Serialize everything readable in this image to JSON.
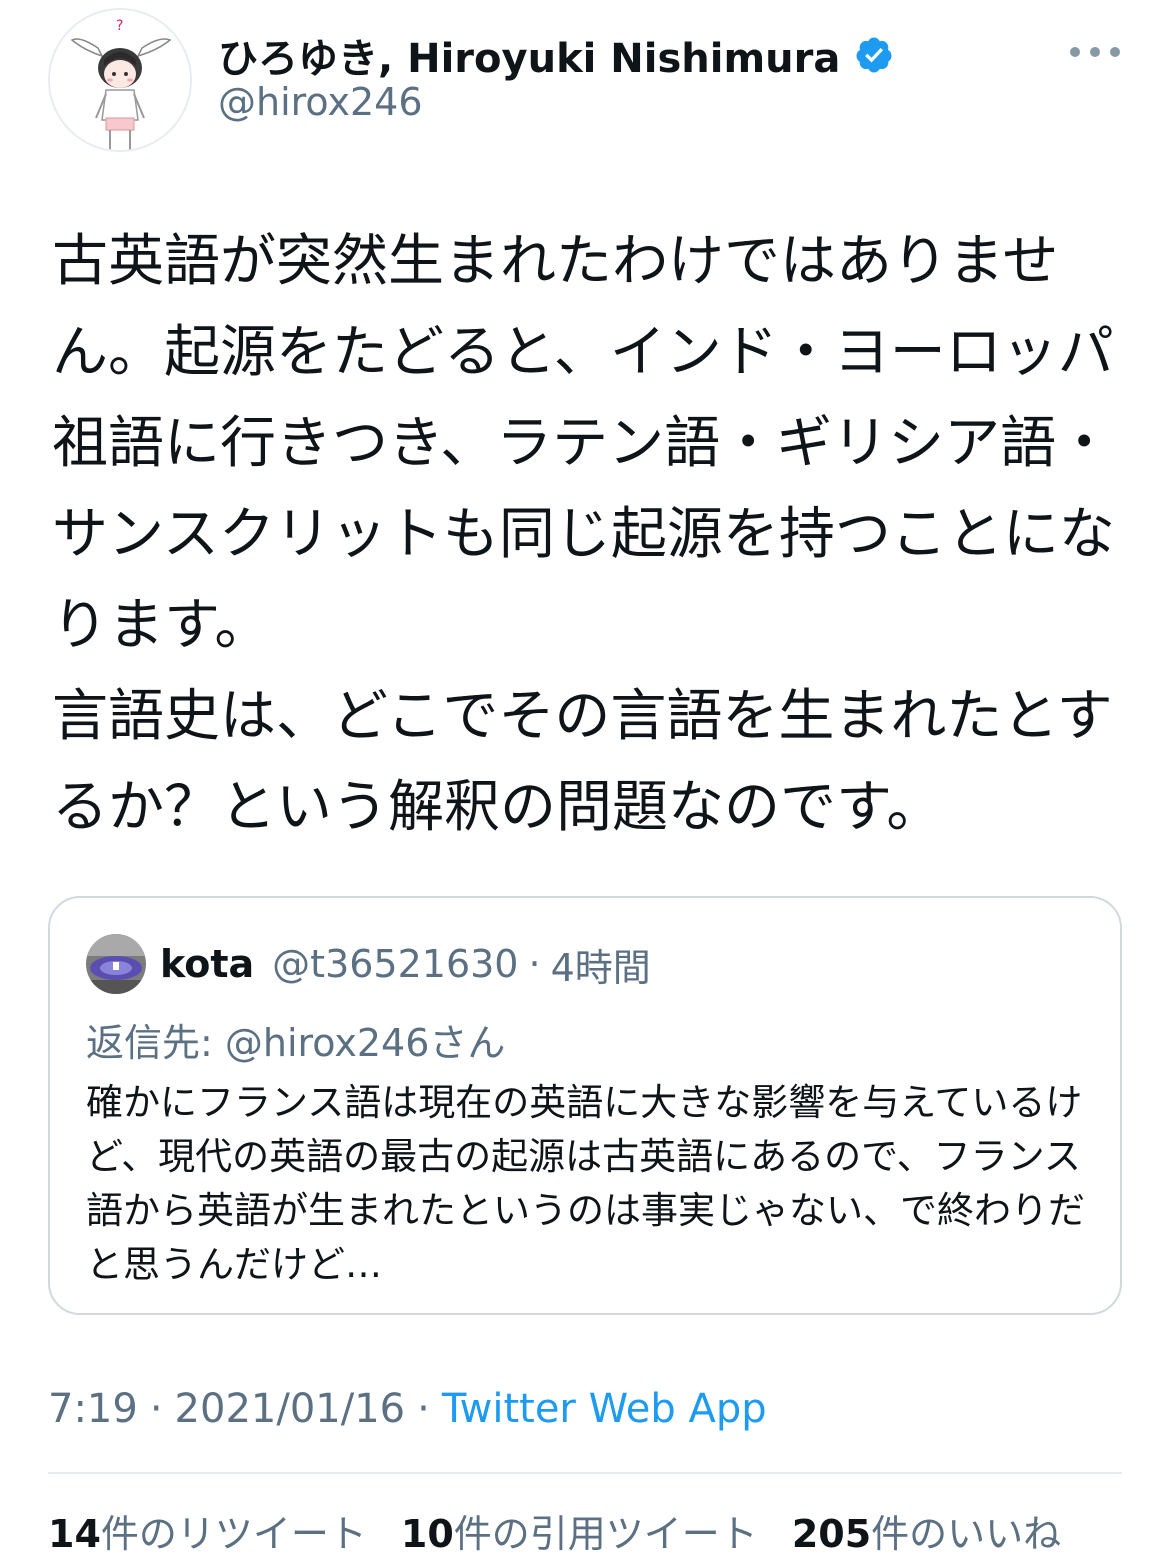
{
  "author": {
    "name": "ひろゆき, Hiroyuki Nishimura",
    "handle": "@hirox246",
    "verified": true
  },
  "tweet": {
    "text": "古英語が突然生まれたわけではありません。起源をたどると、インド・ヨーロッパ祖語に行きつき、ラテン語・ギリシア語・サンスクリットも同じ起源を持つことになります。\n言語史は、どこでその言語を生まれたとするか？という解釈の問題なのです。"
  },
  "quoted_tweet": {
    "name": "kota",
    "handle": "@t36521630",
    "dot": "·",
    "time": "4時間",
    "reply_to": "返信先: @hirox246さん",
    "text": "確かにフランス語は現在の英語に大きな影響を与えているけど、現代の英語の最古の起源は古英語にあるので、フランス語から英語が生まれたというのは事実じゃない、で終わりだと思うんだけど…"
  },
  "meta": {
    "time": "7:19",
    "sep": "·",
    "date": "2021/01/16",
    "source": "Twitter Web App"
  },
  "stats": {
    "retweets": {
      "count": "14",
      "label": "件のリツイート"
    },
    "quotes": {
      "count": "10",
      "label": "件の引用ツイート"
    },
    "likes": {
      "count": "205",
      "label": "件のいいね"
    }
  },
  "colors": {
    "text": "#0f1419",
    "secondary": "#5b7083",
    "accent": "#1d9bf0",
    "border": "#cfd9de"
  },
  "icons": {
    "verified": "verified-badge-icon",
    "more": "more-options-icon"
  }
}
